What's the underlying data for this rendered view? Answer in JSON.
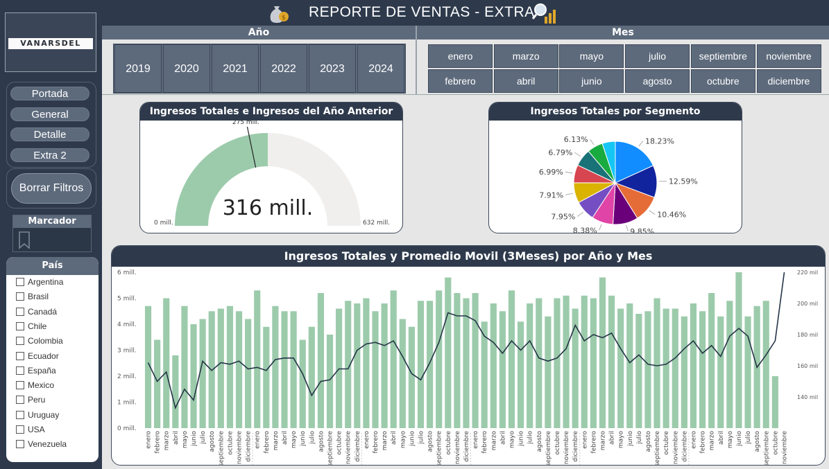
{
  "header": {
    "title": "REPORTE DE VENTAS - EXTRA"
  },
  "logo": {
    "text": "VANARSDEL"
  },
  "nav": {
    "items": [
      "Portada",
      "General",
      "Detalle",
      "Extra 2"
    ],
    "clear_filters": "Borrar Filtros"
  },
  "bookmark": {
    "title": "Marcador"
  },
  "country_filter": {
    "title": "País",
    "items": [
      "Argentina",
      "Brasil",
      "Canadá",
      "Chile",
      "Colombia",
      "Ecuador",
      "España",
      "Mexico",
      "Peru",
      "Uruguay",
      "USA",
      "Venezuela"
    ]
  },
  "year_slicer": {
    "title": "Año",
    "years": [
      "2019",
      "2020",
      "2021",
      "2022",
      "2023",
      "2024"
    ]
  },
  "month_slicer": {
    "title": "Mes",
    "row1": [
      "enero",
      "marzo",
      "mayo",
      "julio",
      "septiembre",
      "noviembre"
    ],
    "row2": [
      "febrero",
      "abril",
      "junio",
      "agosto",
      "octubre",
      "diciembre"
    ]
  },
  "gauge": {
    "title": "Ingresos Totales e Ingresos del Año Anterior",
    "value_label": "316 mill.",
    "target_label": "275 mill.",
    "min_label": "0 mill.",
    "max_label": "632 mill.",
    "value": 316,
    "target": 275,
    "min": 0,
    "max": 632,
    "fill_color": "#9ccbab",
    "track_color": "#f0efed"
  },
  "pie": {
    "title": "Ingresos Totales por Segmento",
    "slices": [
      {
        "value": 18.23,
        "label": "18.23%",
        "color": "#118dff"
      },
      {
        "value": 12.59,
        "label": "12.59%",
        "color": "#12239e"
      },
      {
        "value": 10.46,
        "label": "10.46%",
        "color": "#e66c37"
      },
      {
        "value": 9.85,
        "label": "9.85%",
        "color": "#6b007b"
      },
      {
        "value": 8.38,
        "label": "8.38%",
        "color": "#e044a7"
      },
      {
        "value": 7.95,
        "label": "7.95%",
        "color": "#744ec2"
      },
      {
        "value": 7.91,
        "label": "7.91%",
        "color": "#d9b300"
      },
      {
        "value": 6.99,
        "label": "6.99%",
        "color": "#d64550"
      },
      {
        "value": 6.79,
        "label": "6.79%",
        "color": "#197278"
      },
      {
        "value": 6.13,
        "label": "6.13%",
        "color": "#1aab40"
      },
      {
        "value": 5.12,
        "label": "",
        "color": "#15c6f4"
      }
    ]
  },
  "chart_data": {
    "type": "bar",
    "title": "Ingresos Totales y Promedio Movil (3Meses) por Año y Mes",
    "bar_color": "#9ccbab",
    "line_color": "#253447",
    "y_left_ticks": [
      "0 mill.",
      "1 mill.",
      "2 mill.",
      "3 mill.",
      "4 mill.",
      "5 mill.",
      "6 mill."
    ],
    "y_right_ticks": [
      "140 mil",
      "160 mil",
      "180 mil",
      "200 mil",
      "220 mil"
    ],
    "ylim_left": [
      0,
      6
    ],
    "ylim_right": [
      120,
      220
    ],
    "years": [
      "2019",
      "2020",
      "2021",
      "2022",
      "2023",
      "2024"
    ],
    "categories": [
      "enero",
      "febrero",
      "marzo",
      "abril",
      "mayo",
      "junio",
      "julio",
      "agosto",
      "septiembre",
      "octubre",
      "noviembre",
      "diciembre",
      "enero",
      "febrero",
      "marzo",
      "abril",
      "mayo",
      "junio",
      "julio",
      "agosto",
      "septiembre",
      "octubre",
      "noviembre",
      "diciembre",
      "enero",
      "febrero",
      "marzo",
      "abril",
      "mayo",
      "junio",
      "julio",
      "agosto",
      "septiembre",
      "octubre",
      "noviembre",
      "diciembre",
      "enero",
      "febrero",
      "marzo",
      "abril",
      "mayo",
      "junio",
      "julio",
      "agosto",
      "septiembre",
      "octubre",
      "noviembre",
      "diciembre",
      "enero",
      "febrero",
      "marzo",
      "abril",
      "mayo",
      "junio",
      "julio",
      "agosto",
      "septiembre",
      "octubre",
      "noviembre",
      "diciembre",
      "enero",
      "febrero",
      "marzo",
      "abril",
      "mayo",
      "junio",
      "julio",
      "agosto",
      "septiembre",
      "octubre",
      "noviembre"
    ],
    "series": [
      {
        "name": "Ingresos Totales",
        "values": [
          4.7,
          3.4,
          5.0,
          2.8,
          4.7,
          4.0,
          4.2,
          4.5,
          4.6,
          4.7,
          4.5,
          4.2,
          5.3,
          3.9,
          4.7,
          4.5,
          4.5,
          3.4,
          3.9,
          5.2,
          3.6,
          4.6,
          4.9,
          4.8,
          5.0,
          4.5,
          4.8,
          5.3,
          4.2,
          3.9,
          4.9,
          4.9,
          5.3,
          5.8,
          5.2,
          5.0,
          5.2,
          4.1,
          4.8,
          4.5,
          5.3,
          4.1,
          4.8,
          5.0,
          4.3,
          5.0,
          5.1,
          4.6,
          5.1,
          5.0,
          5.8,
          5.1,
          4.6,
          4.8,
          4.4,
          4.5,
          5.0,
          4.6,
          4.6,
          4.3,
          4.8,
          4.5,
          5.2,
          4.3,
          4.9,
          6.0,
          4.3,
          4.7,
          4.9,
          2.0,
          0,
          0,
          0
        ]
      },
      {
        "name": "Promedio Movil (3Meses)",
        "values": [
          162,
          150,
          156,
          133,
          145,
          138,
          163,
          157,
          162,
          161,
          163,
          158,
          159,
          157,
          164,
          165,
          165,
          155,
          141,
          150,
          151,
          158,
          158,
          170,
          174,
          175,
          173,
          176,
          166,
          155,
          151,
          162,
          175,
          194,
          192,
          192,
          189,
          179,
          175,
          168,
          176,
          170,
          176,
          165,
          163,
          165,
          171,
          186,
          176,
          180,
          178,
          181,
          171,
          162,
          167,
          161,
          160,
          161,
          165,
          171,
          176,
          168,
          173,
          166,
          179,
          184,
          179,
          159,
          167,
          176,
          220,
          0,
          0
        ]
      }
    ]
  }
}
